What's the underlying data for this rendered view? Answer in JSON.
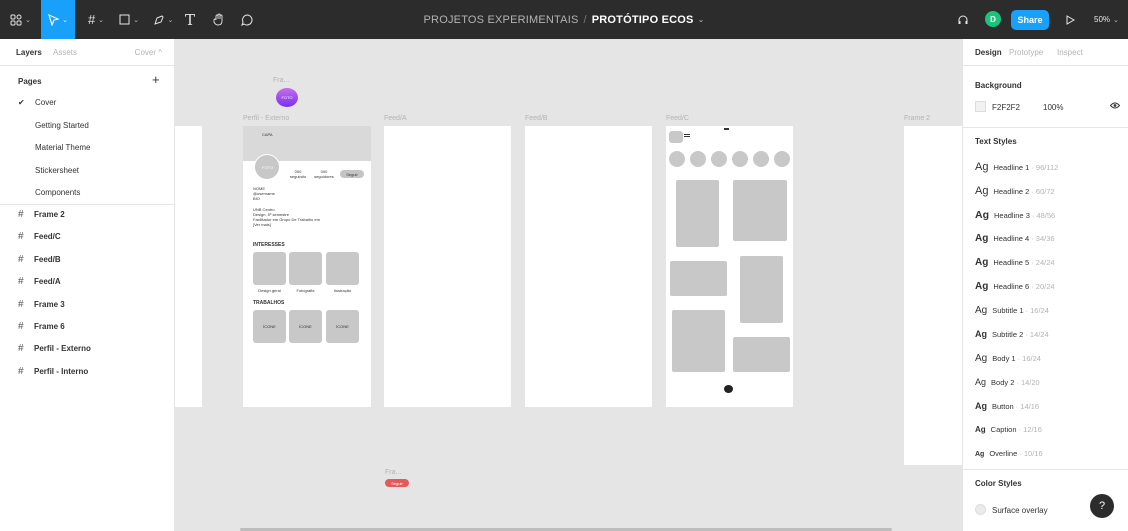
{
  "toolbar": {
    "main_menu_icon": "figma-menu-icon",
    "move_tool_icon": "move-cursor-icon",
    "frame_tool_icon": "frame-hash-icon",
    "shape_tool_icon": "rectangle-icon",
    "pen_tool_icon": "pen-icon",
    "text_tool_label": "T",
    "hand_tool_icon": "hand-icon",
    "comment_tool_icon": "comment-icon",
    "project": "PROJETOS EXPERIMENTAIS",
    "separator": "/",
    "file_name": "PROTÓTIPO ECOS",
    "avatar_initial": "D",
    "share_label": "Share",
    "play_icon": "play-icon",
    "zoom": "50%",
    "accent": "#18a0fb"
  },
  "left_panel": {
    "tabs": [
      "Layers",
      "Assets"
    ],
    "page_selector": "Cover ^",
    "pages_title": "Pages",
    "add_page": "+",
    "pages": [
      "Cover",
      "Getting Started",
      "Material Theme",
      "Stickersheet",
      "Components"
    ],
    "layers": [
      "Frame 2",
      "Feed/C",
      "Feed/B",
      "Feed/A",
      "Frame 3",
      "Frame 6",
      "Perfil - Externo",
      "Perfil - Interno"
    ]
  },
  "canvas": {
    "frame_labels": {
      "fra_top": "Fra...",
      "perfil": "Perfil - Externo",
      "feed_a": "Feed/A",
      "feed_b": "Feed/B",
      "feed_c": "Feed/C",
      "frame2": "Frame 2",
      "fra_bottom": "Fra..."
    },
    "foto_badge": "FOTO",
    "seguir_badge": "Seguir",
    "profile": {
      "capa": "CAPA",
      "foto": "FOTO",
      "seguindo": "000 seguindo",
      "seguidores": "000 seguidores",
      "seguir_btn": "Seguir",
      "nome": "NOME",
      "username": "@username",
      "bio": "BIO",
      "uni": "UNB Centro",
      "curso": "Design, 5º semestre",
      "grupo": "Facilitador em Grupo De Trabalho em [Ver mais]",
      "interesses_title": "INTERESSES",
      "interesses": [
        "Design geral",
        "Fotografia",
        "Ilustração"
      ],
      "trabalhos_title": "TRABALHOS",
      "trabalhos": [
        "ÍCONE",
        "ÍCONE",
        "ÍCONE"
      ]
    }
  },
  "right_panel": {
    "tabs": [
      "Design",
      "Prototype",
      "Inspect"
    ],
    "background_title": "Background",
    "background_hex": "F2F2F2",
    "background_opacity": "100%",
    "text_styles_title": "Text Styles",
    "text_styles": [
      {
        "name": "Headline 1",
        "meta": "· 96/112"
      },
      {
        "name": "Headline 2",
        "meta": "· 60/72"
      },
      {
        "name": "Headline 3",
        "meta": "· 48/56"
      },
      {
        "name": "Headline 4",
        "meta": "· 34/36"
      },
      {
        "name": "Headline 5",
        "meta": "· 24/24"
      },
      {
        "name": "Headline 6",
        "meta": "· 20/24"
      },
      {
        "name": "Subtitle 1",
        "meta": "· 16/24"
      },
      {
        "name": "Subtitle 2",
        "meta": "· 14/24"
      },
      {
        "name": "Body 1",
        "meta": "· 16/24"
      },
      {
        "name": "Body 2",
        "meta": "· 14/20"
      },
      {
        "name": "Button",
        "meta": "· 14/16"
      },
      {
        "name": "Caption",
        "meta": "· 12/16"
      },
      {
        "name": "Overline",
        "meta": "· 10/16"
      }
    ],
    "ag": "Ag",
    "color_styles_title": "Color Styles",
    "color_styles": [
      "Surface overlay"
    ],
    "help": "?"
  }
}
